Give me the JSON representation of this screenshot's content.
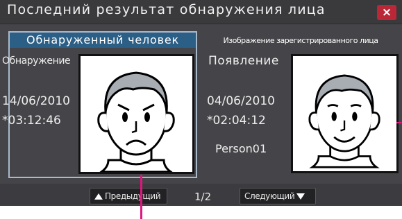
{
  "window": {
    "title": "Последний результат обнаружения лица",
    "close_glyph": "×"
  },
  "detected": {
    "header": "Обнаруженный человек",
    "event": "Обнаружение",
    "date": "14/06/2010",
    "time": "*03:12:46",
    "face_expression": "frown"
  },
  "registered": {
    "header": "Изображение зарегистрированного лица",
    "event": "Появление",
    "date": "04/06/2010",
    "time": "*02:04:12",
    "name": "Person01",
    "face_expression": "smile"
  },
  "nav": {
    "prev_label": "Предыдущий",
    "next_label": "Следующий",
    "page_indicator": "1/2"
  },
  "colors": {
    "panel": "#454448",
    "header_highlight": "#2b5f86",
    "close": "#ba2838",
    "callout": "#e0157f",
    "selection_border": "#a9b9cc"
  },
  "icons": {
    "prev": "triangle-up-icon",
    "next": "triangle-down-icon",
    "close": "close-icon"
  }
}
